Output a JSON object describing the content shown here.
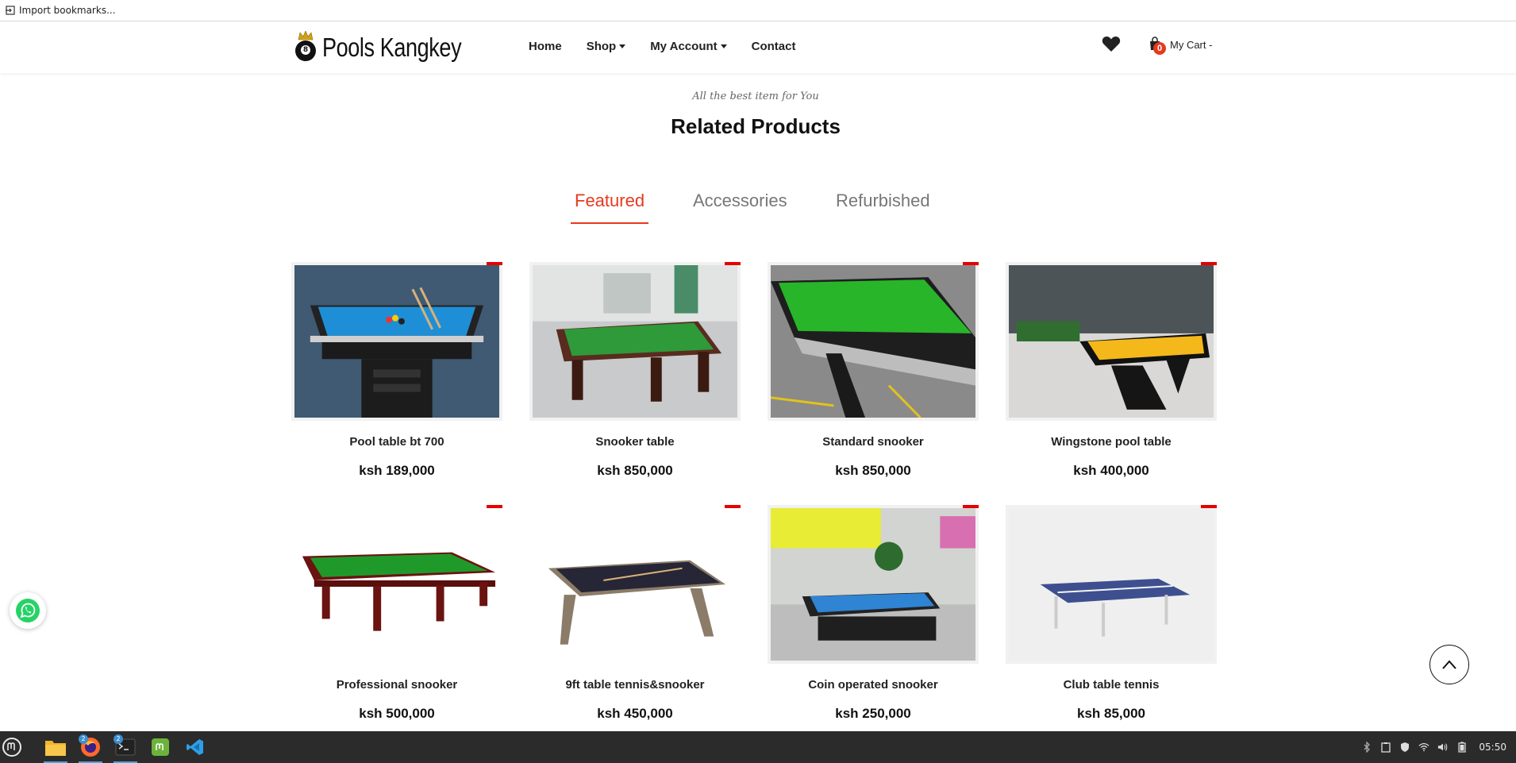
{
  "bookmarks_bar": {
    "import_label": "Import bookmarks..."
  },
  "header": {
    "logo_text": "Pools Kangkey",
    "logo_ball_number": "8",
    "nav": [
      {
        "label": "Home",
        "has_caret": false
      },
      {
        "label": "Shop",
        "has_caret": true
      },
      {
        "label": "My Account",
        "has_caret": true
      },
      {
        "label": "Contact",
        "has_caret": false
      }
    ],
    "cart_count": "0",
    "cart_label": "My Cart -"
  },
  "section": {
    "subtitle": "All the best item for You",
    "title": "Related Products"
  },
  "tabs": [
    {
      "label": "Featured",
      "active": true
    },
    {
      "label": "Accessories",
      "active": false
    },
    {
      "label": "Refurbished",
      "active": false
    }
  ],
  "products": [
    {
      "name": "Pool table bt 700",
      "price": "ksh 189,000"
    },
    {
      "name": "Snooker table",
      "price": "ksh 850,000"
    },
    {
      "name": "Standard snooker",
      "price": "ksh 850,000"
    },
    {
      "name": "Wingstone pool table",
      "price": "ksh 400,000"
    },
    {
      "name": "Professional snooker",
      "price": "ksh 500,000"
    },
    {
      "name": "9ft table tennis&snooker",
      "price": "ksh 450,000"
    },
    {
      "name": "Coin operated snooker",
      "price": "ksh 250,000"
    },
    {
      "name": "Club table tennis",
      "price": "ksh 85,000"
    }
  ],
  "taskbar": {
    "apps": [
      {
        "icon": "mint-menu-icon",
        "badge": ""
      },
      {
        "icon": "files-icon",
        "badge": ""
      },
      {
        "icon": "firefox-icon",
        "badge": "2"
      },
      {
        "icon": "terminal-icon",
        "badge": "2"
      },
      {
        "icon": "mint-update-icon",
        "badge": ""
      },
      {
        "icon": "vscode-icon",
        "badge": ""
      }
    ],
    "clock": "05:50"
  },
  "colors": {
    "accent": "#e53a1e",
    "badge_red": "#e60000",
    "taskbar": "#2b2b2b"
  }
}
